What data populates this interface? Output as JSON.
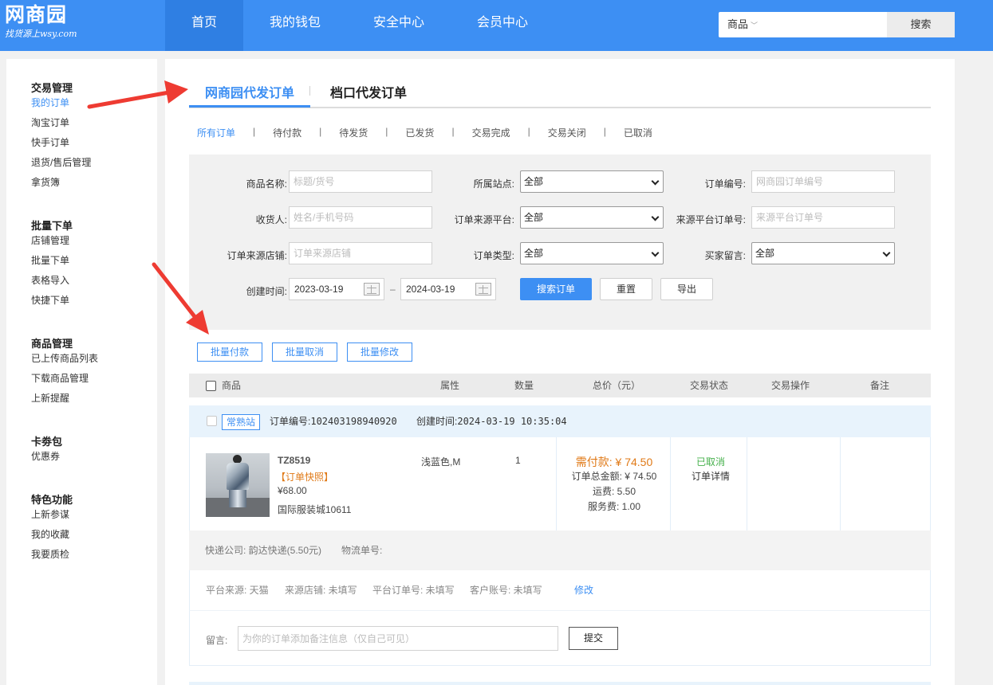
{
  "header": {
    "logo_main": "网商园",
    "logo_sub": "找货源上wsy.com",
    "nav": [
      "首页",
      "我的钱包",
      "安全中心",
      "会员中心"
    ],
    "search": {
      "category": "商品",
      "placeholder": "",
      "button": "搜索"
    }
  },
  "sidebar": {
    "groups": [
      {
        "title": "交易管理",
        "items": [
          "我的订单",
          "淘宝订单",
          "快手订单",
          "退货/售后管理",
          "拿货簿"
        ]
      },
      {
        "title": "批量下单",
        "items": [
          "店铺管理",
          "批量下单",
          "表格导入",
          "快捷下单"
        ]
      },
      {
        "title": "商品管理",
        "items": [
          "已上传商品列表",
          "下载商品管理",
          "上新提醒"
        ]
      },
      {
        "title": "卡劵包",
        "items": [
          "优惠券"
        ]
      },
      {
        "title": "特色功能",
        "items": [
          "上新参谋",
          "我的收藏",
          "我要质检"
        ]
      }
    ],
    "active_item": "我的订单"
  },
  "main": {
    "tabs": [
      "网商园代发订单",
      "档口代发订单"
    ],
    "sub_filters": [
      "所有订单",
      "待付款",
      "待发货",
      "已发货",
      "交易完成",
      "交易关闭",
      "已取消"
    ],
    "filter": {
      "product_name": {
        "label": "商品名称:",
        "placeholder": "标题/货号"
      },
      "site": {
        "label": "所属站点:",
        "value": "全部"
      },
      "order_no": {
        "label": "订单编号:",
        "placeholder": "网商园订单编号"
      },
      "receiver": {
        "label": "收货人:",
        "placeholder": "姓名/手机号码"
      },
      "source_platform": {
        "label": "订单来源平台:",
        "value": "全部"
      },
      "source_order_no": {
        "label": "来源平台订单号:",
        "placeholder": "来源平台订单号"
      },
      "source_shop": {
        "label": "订单来源店铺:",
        "placeholder": "订单来源店铺"
      },
      "order_type": {
        "label": "订单类型:",
        "value": "全部"
      },
      "buyer_note": {
        "label": "买家留言:",
        "value": "全部"
      },
      "created": {
        "label": "创建时间:",
        "from": "2023-03-19",
        "dash": "–",
        "to": "2024-03-19"
      },
      "search_button": "搜索订单",
      "reset_button": "重置",
      "export_button": "导出"
    },
    "batch": [
      "批量付款",
      "批量取消",
      "批量修改"
    ],
    "table_headers": [
      "商品",
      "属性",
      "数量",
      "总价（元）",
      "交易状态",
      "交易操作",
      "备注"
    ],
    "order": {
      "badge": "常熟站",
      "order_no_label": "订单编号:",
      "order_no": "102403198940920",
      "created_label": "创建时间:",
      "created": "2024-03-19 10:35:04",
      "product": {
        "code": "TZ8519",
        "snapshot": "【订单快照】",
        "price": "¥68.00",
        "mall": "国际服装城10611"
      },
      "attribute": "浅蓝色,M",
      "quantity": "1",
      "need_pay": "需付款: ¥ 74.50",
      "total": "订单总金额: ¥ 74.50",
      "shipping": "运费:  5.50",
      "service": "服务费:  1.00",
      "status": "已取消",
      "detail": "订单详情",
      "express": "快递公司: 韵达快递(5.50元)",
      "tracking": "物流单号:",
      "platform_source": "平台来源: 天猫",
      "source_shop": "来源店铺: 未填写",
      "platform_order_no": "平台订单号: 未填写",
      "customer_account": "客户账号: 未填写",
      "edit": "修改",
      "remark_label": "留言:",
      "remark_placeholder": "为你的订单添加备注信息（仅自己可见）",
      "submit": "提交"
    }
  },
  "colors": {
    "brand": "#3d8ff3",
    "warning": "#e07a18",
    "success": "#45b04b",
    "annotation": "#ee3b32"
  }
}
